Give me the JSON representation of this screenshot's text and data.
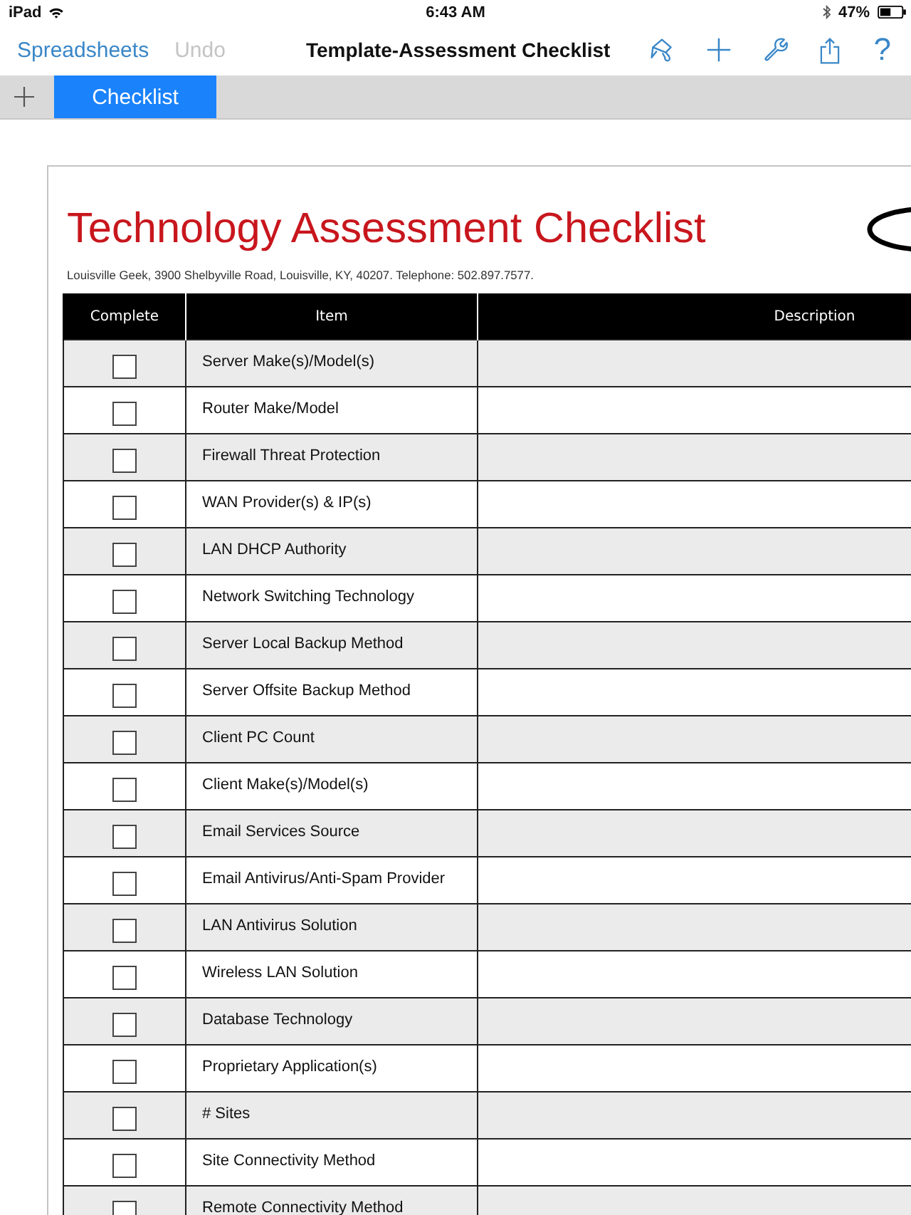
{
  "status_bar": {
    "device": "iPad",
    "time": "6:43 AM",
    "battery": "47%"
  },
  "nav_bar": {
    "back": "Spreadsheets",
    "undo": {
      "label": "Undo",
      "disabled": true
    },
    "title": "Template-Assessment Checklist",
    "help": "?"
  },
  "sheet_tabs": [
    {
      "label": "Checklist",
      "selected": true
    }
  ],
  "document": {
    "title": "Technology Assessment Checklist",
    "address": "Louisville Geek, 3900 Shelbyville Road, Louisville, KY, 40207. Telephone: 502.897.7577.",
    "table": {
      "columns": [
        "Complete",
        "Item",
        "Description"
      ],
      "rows": [
        {
          "item": "Server Make(s)/Model(s)",
          "checked": false
        },
        {
          "item": "Router Make/Model",
          "checked": false
        },
        {
          "item": "Firewall Threat Protection",
          "checked": false
        },
        {
          "item": "WAN Provider(s) & IP(s)",
          "checked": false
        },
        {
          "item": "LAN DHCP Authority",
          "checked": false
        },
        {
          "item": "Network Switching Technology",
          "checked": false
        },
        {
          "item": "Server Local Backup Method",
          "checked": false
        },
        {
          "item": "Server Offsite Backup Method",
          "checked": false
        },
        {
          "item": "Client PC Count",
          "checked": false
        },
        {
          "item": "Client Make(s)/Model(s)",
          "checked": false
        },
        {
          "item": "Email Services Source",
          "checked": false
        },
        {
          "item": "Email Antivirus/Anti-Spam Provider",
          "checked": false
        },
        {
          "item": "LAN Antivirus Solution",
          "checked": false
        },
        {
          "item": "Wireless LAN Solution",
          "checked": false
        },
        {
          "item": "Database Technology",
          "checked": false
        },
        {
          "item": "Proprietary Application(s)",
          "checked": false
        },
        {
          "item": "# Sites",
          "checked": false
        },
        {
          "item": "Site Connectivity Method",
          "checked": false
        },
        {
          "item": "Remote Connectivity Method",
          "checked": false
        }
      ]
    }
  }
}
